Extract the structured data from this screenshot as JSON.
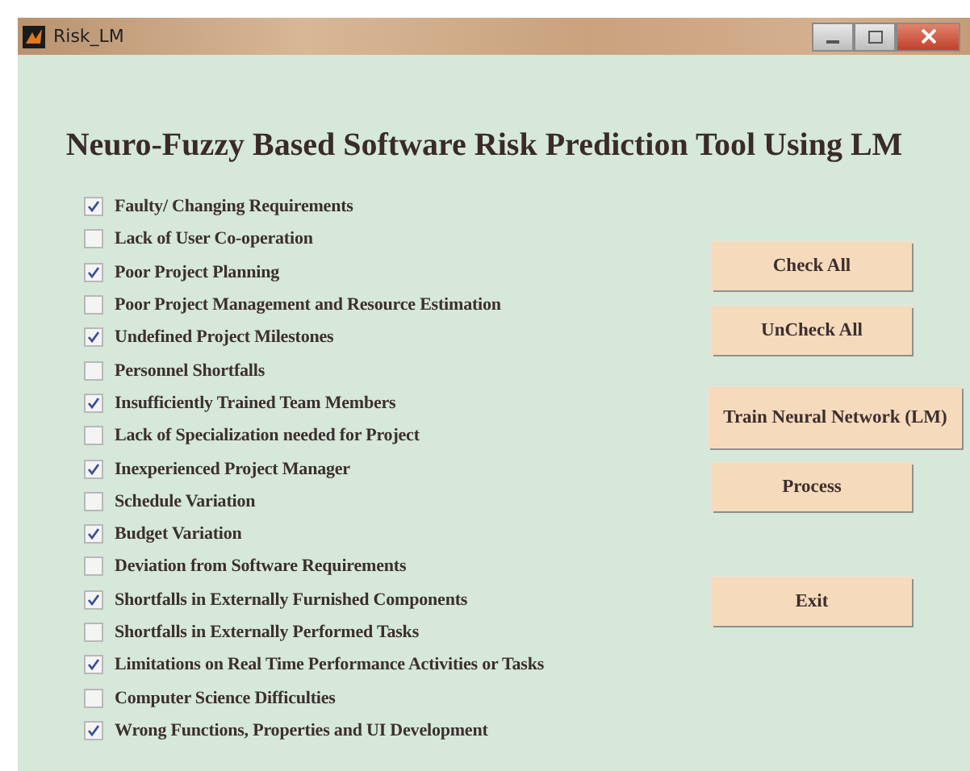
{
  "window": {
    "title": "Risk_LM"
  },
  "heading": "Neuro-Fuzzy Based Software Risk Prediction Tool Using LM",
  "risks": [
    {
      "label": "Faulty/ Changing Requirements",
      "checked": true
    },
    {
      "label": "Lack of User Co-operation",
      "checked": false
    },
    {
      "label": "Poor Project Planning",
      "checked": true
    },
    {
      "label": "Poor Project Management and Resource Estimation",
      "checked": false
    },
    {
      "label": "Undefined Project Milestones",
      "checked": true
    },
    {
      "label": "Personnel Shortfalls",
      "checked": false
    },
    {
      "label": "Insufficiently Trained Team Members",
      "checked": true
    },
    {
      "label": "Lack of Specialization needed for Project",
      "checked": false
    },
    {
      "label": "Inexperienced Project Manager",
      "checked": true
    },
    {
      "label": "Schedule Variation",
      "checked": false
    },
    {
      "label": "Budget Variation",
      "checked": true
    },
    {
      "label": "Deviation from Software Requirements",
      "checked": false
    },
    {
      "label": "Shortfalls in Externally Furnished Components",
      "checked": true
    },
    {
      "label": "Shortfalls in Externally Performed Tasks",
      "checked": false
    },
    {
      "label": "Limitations on Real Time Performance Activities or Tasks",
      "checked": true
    },
    {
      "label": "Computer Science Difficulties",
      "checked": false
    },
    {
      "label": "Wrong Functions, Properties and UI Development",
      "checked": true
    }
  ],
  "buttons": [
    "Check All",
    "UnCheck All",
    "Train Neural Network (LM)",
    "Process",
    "Exit"
  ]
}
